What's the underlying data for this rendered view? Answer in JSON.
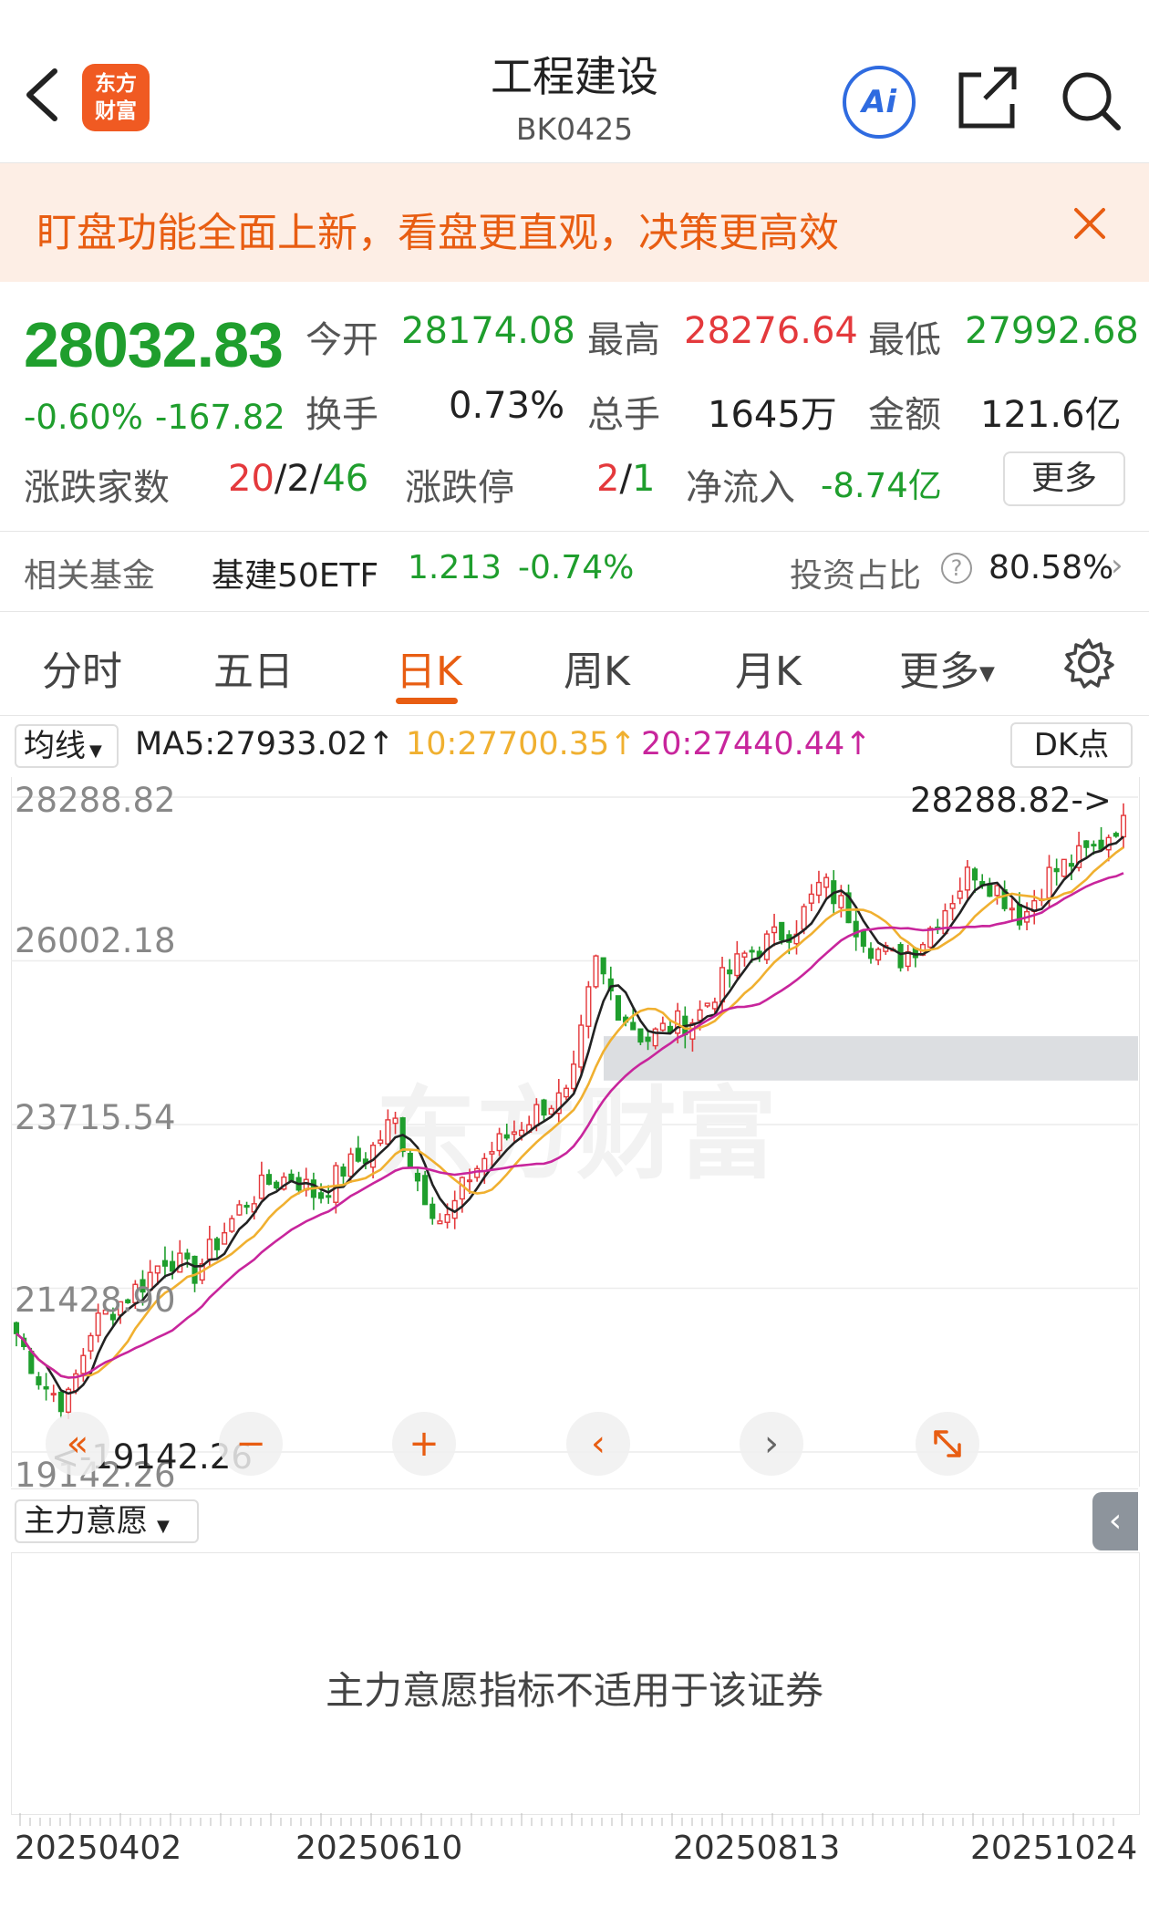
{
  "header": {
    "logo_line1": "东方",
    "logo_line2": "财富",
    "title": "工程建设",
    "code": "BK0425",
    "ai_label": "Ai"
  },
  "banner": {
    "text": "盯盘功能全面上新，看盘更直观，决策更高效"
  },
  "quote": {
    "price": "28032.83",
    "change_pct": "-0.60%",
    "change_abs": "-167.82",
    "open_label": "今开",
    "open": "28174.08",
    "high_label": "最高",
    "high": "28276.64",
    "low_label": "最低",
    "low": "27992.68",
    "turnover_label": "换手",
    "turnover": "0.73%",
    "volume_label": "总手",
    "volume": "1645万",
    "amount_label": "金额",
    "amount": "121.6亿",
    "updown_label": "涨跌家数",
    "up": "20",
    "flat": "2",
    "down": "46",
    "limit_label": "涨跌停",
    "limit_up": "2",
    "limit_down": "1",
    "netflow_label": "净流入",
    "netflow": "-8.74亿",
    "more_label": "更多"
  },
  "fund": {
    "label": "相关基金",
    "name": "基建50ETF",
    "price": "1.213",
    "change": "-0.74%",
    "ratio_label": "投资占比",
    "ratio": "80.58%"
  },
  "tabs": [
    "分时",
    "五日",
    "日K",
    "周K",
    "月K",
    "更多"
  ],
  "ma": {
    "dropdown": "均线",
    "ma5": "MA5:27933.02↑",
    "ma10": "10:27700.35↑",
    "ma20": "20:27440.44↑",
    "dk": "DK点"
  },
  "colors": {
    "up": "#e4393c",
    "down": "#1f9e2d",
    "accent": "#e85d12",
    "ma5": "#222222",
    "ma10": "#f0b030",
    "ma20": "#c8259c"
  },
  "chart": {
    "y_ticks": [
      "28288.82",
      "26002.18",
      "23715.54",
      "21428.90",
      "19142.26"
    ],
    "max_marker": "28288.82->",
    "min_marker": "<-19142.26"
  },
  "indicator": {
    "dropdown": "主力意愿",
    "message": "主力意愿指标不适用于该证券"
  },
  "dates": [
    "20250402",
    "20250610",
    "20250813",
    "20251024"
  ],
  "chart_data": {
    "type": "candlestick",
    "ylim": [
      19142.26,
      28288.82
    ],
    "y_ticks": [
      28288.82,
      26002.18,
      23715.54,
      21428.9,
      19142.26
    ],
    "x_ticks": [
      "20250402",
      "20250610",
      "20250813",
      "20251024"
    ],
    "series": [
      {
        "name": "MA5",
        "value": 27933.02
      },
      {
        "name": "MA10",
        "value": 27700.35
      },
      {
        "name": "MA20",
        "value": 27440.44
      }
    ],
    "close_path": [
      20800,
      20100,
      19800,
      20900,
      21200,
      21500,
      21900,
      21600,
      22100,
      22600,
      22900,
      23000,
      22700,
      23100,
      23300,
      23800,
      22900,
      22300,
      23000,
      23400,
      23700,
      24000,
      24100,
      26000,
      25300,
      24900,
      25100,
      25200,
      25700,
      26100,
      26300,
      26500,
      27100,
      26700,
      26200,
      26000,
      26300,
      26800,
      27300,
      27000,
      26600,
      27200,
      27400,
      27600,
      28032.83
    ]
  }
}
